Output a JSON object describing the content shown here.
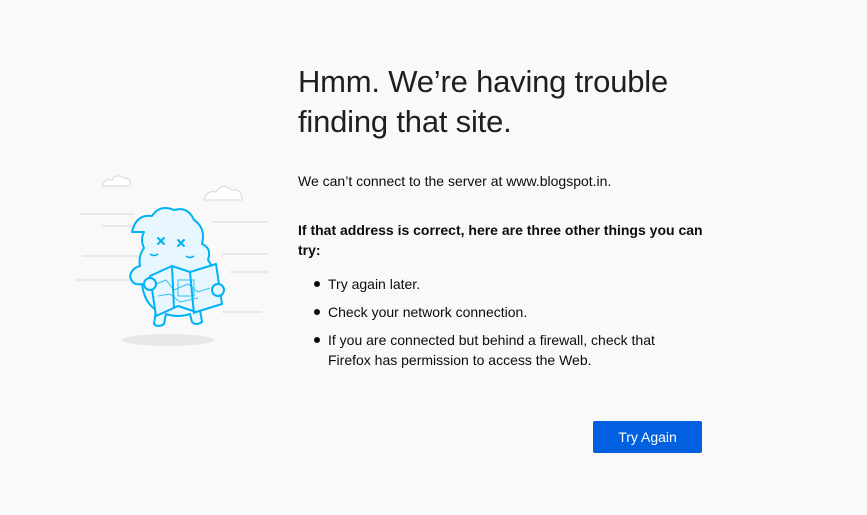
{
  "error": {
    "title": "Hmm. We’re having trouble finding that site.",
    "description": "We can’t connect to the server at www.blogspot.in.",
    "subtitle": "If that address is correct, here are three other things you can try:",
    "tips": [
      "Try again later.",
      "Check your network connection.",
      "If you are connected but behind a firewall, check that Firefox has permission to access the Web."
    ],
    "try_again_label": "Try Again"
  },
  "colors": {
    "background": "#f9f9fa",
    "primary_button": "#0060df",
    "illustration_stroke": "#00b3f4",
    "illustration_fill": "#e8f6fe"
  },
  "icons": {
    "illustration": "lost-map-mascot-illustration"
  }
}
